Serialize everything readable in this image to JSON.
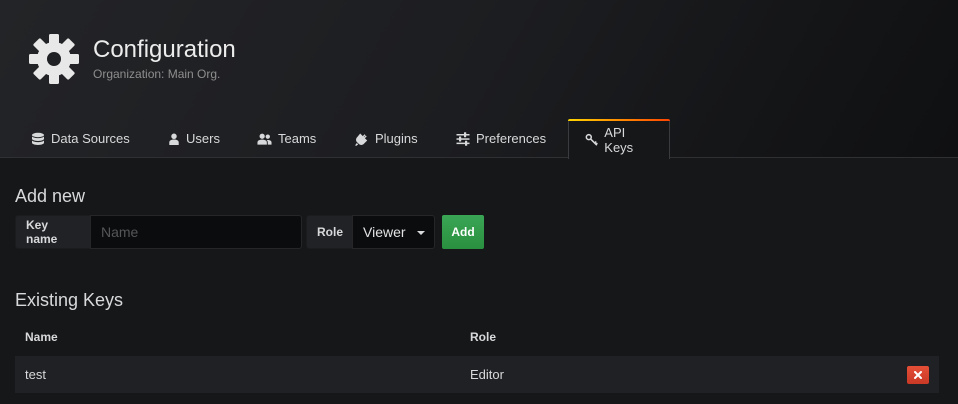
{
  "header": {
    "title": "Configuration",
    "subtitle": "Organization: Main Org.",
    "icon": "gear-icon"
  },
  "tabs": [
    {
      "label": "Data Sources",
      "icon": "database-icon",
      "active": false
    },
    {
      "label": "Users",
      "icon": "user-icon",
      "active": false
    },
    {
      "label": "Teams",
      "icon": "users-icon",
      "active": false
    },
    {
      "label": "Plugins",
      "icon": "plug-icon",
      "active": false
    },
    {
      "label": "Preferences",
      "icon": "sliders-icon",
      "active": false
    },
    {
      "label": "API Keys",
      "icon": "key-icon",
      "active": true
    }
  ],
  "add_new": {
    "title": "Add new",
    "key_name_label": "Key name",
    "key_name_placeholder": "Name",
    "key_name_value": "",
    "role_label": "Role",
    "role_value": "Viewer",
    "add_button": "Add"
  },
  "existing": {
    "title": "Existing Keys",
    "columns": [
      "Name",
      "Role"
    ],
    "rows": [
      {
        "name": "test",
        "role": "Editor"
      }
    ]
  },
  "colors": {
    "background": "#161719",
    "accent_gradient": [
      "#ffd500",
      "#ff4400"
    ],
    "add_button": "#299c46",
    "delete_button": "#d44a3a"
  }
}
